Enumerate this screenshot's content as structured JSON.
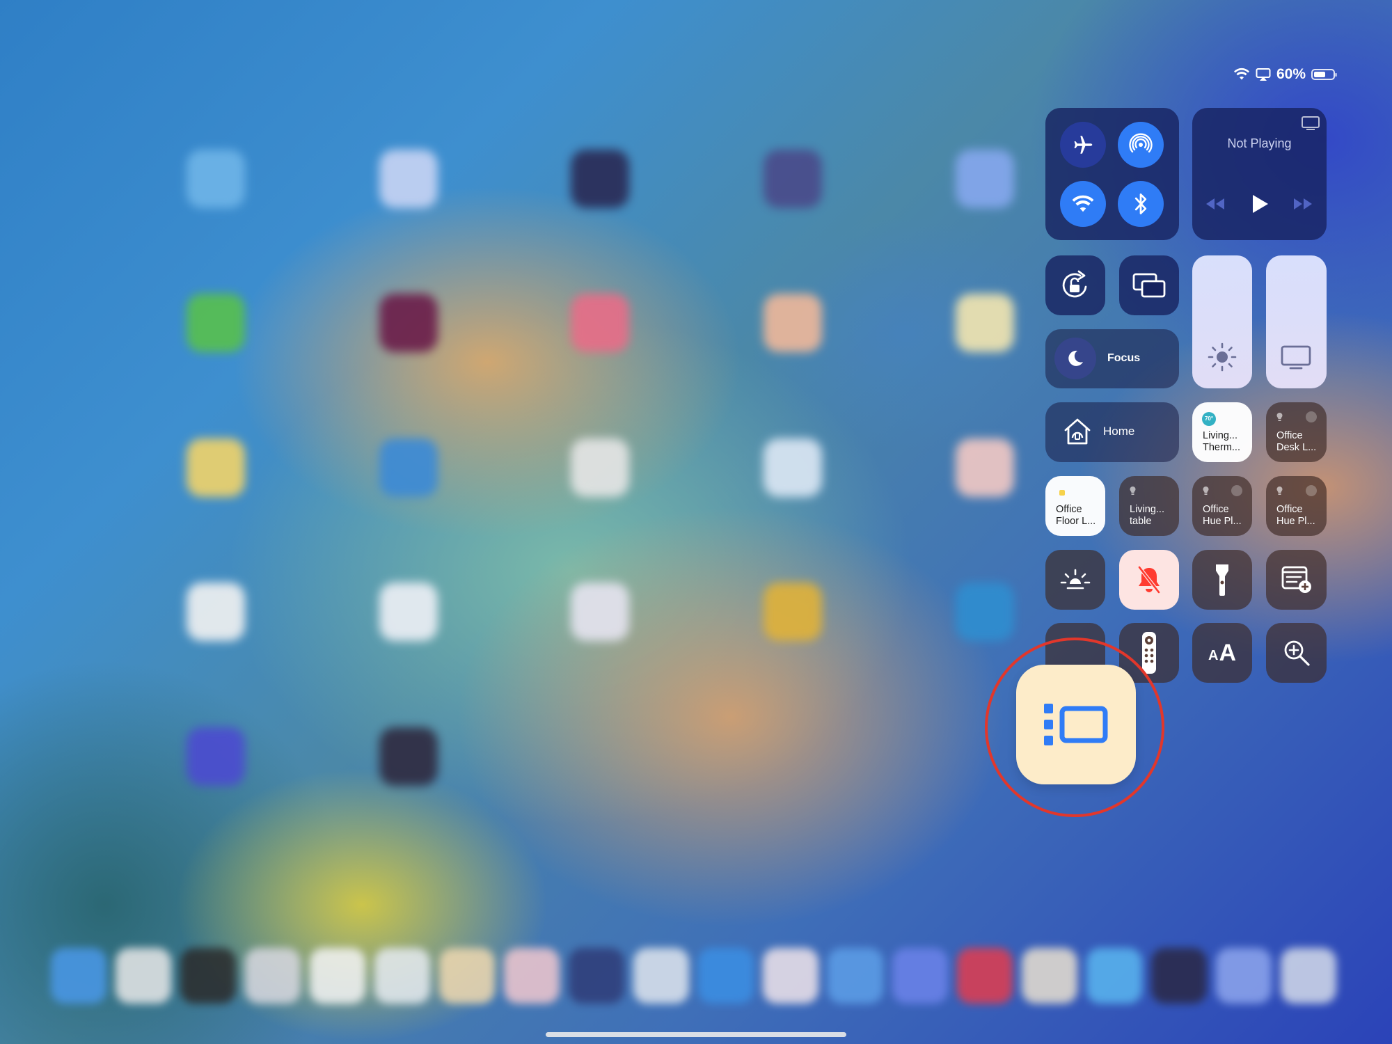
{
  "status_bar": {
    "battery_percent": "60%",
    "battery_level": 0.6
  },
  "now_playing": {
    "title": "Not Playing"
  },
  "focus": {
    "label": "Focus"
  },
  "home": {
    "label": "Home"
  },
  "home_accessories": [
    {
      "line1": "Living...",
      "line2": "Therm...",
      "badge": "70°",
      "state": "on"
    },
    {
      "line1": "Office",
      "line2": "Desk L...",
      "state": "off"
    },
    {
      "line1": "Office",
      "line2": "Floor L...",
      "state": "on"
    },
    {
      "line1": "Living...",
      "line2": "table",
      "state": "off"
    },
    {
      "line1": "Office",
      "line2": "Hue Pl...",
      "state": "off"
    },
    {
      "line1": "Office",
      "line2": "Hue Pl...",
      "state": "off"
    }
  ],
  "text_size_glyph": {
    "small": "A",
    "large": "A"
  },
  "highlighted_control": "stage-manager-icon",
  "colors": {
    "accent_blue": "#2f7cf6",
    "highlight_ring": "#e2372b",
    "stage_manager_tile": "#fdecc9",
    "silent_bell": "#ff3b30"
  }
}
